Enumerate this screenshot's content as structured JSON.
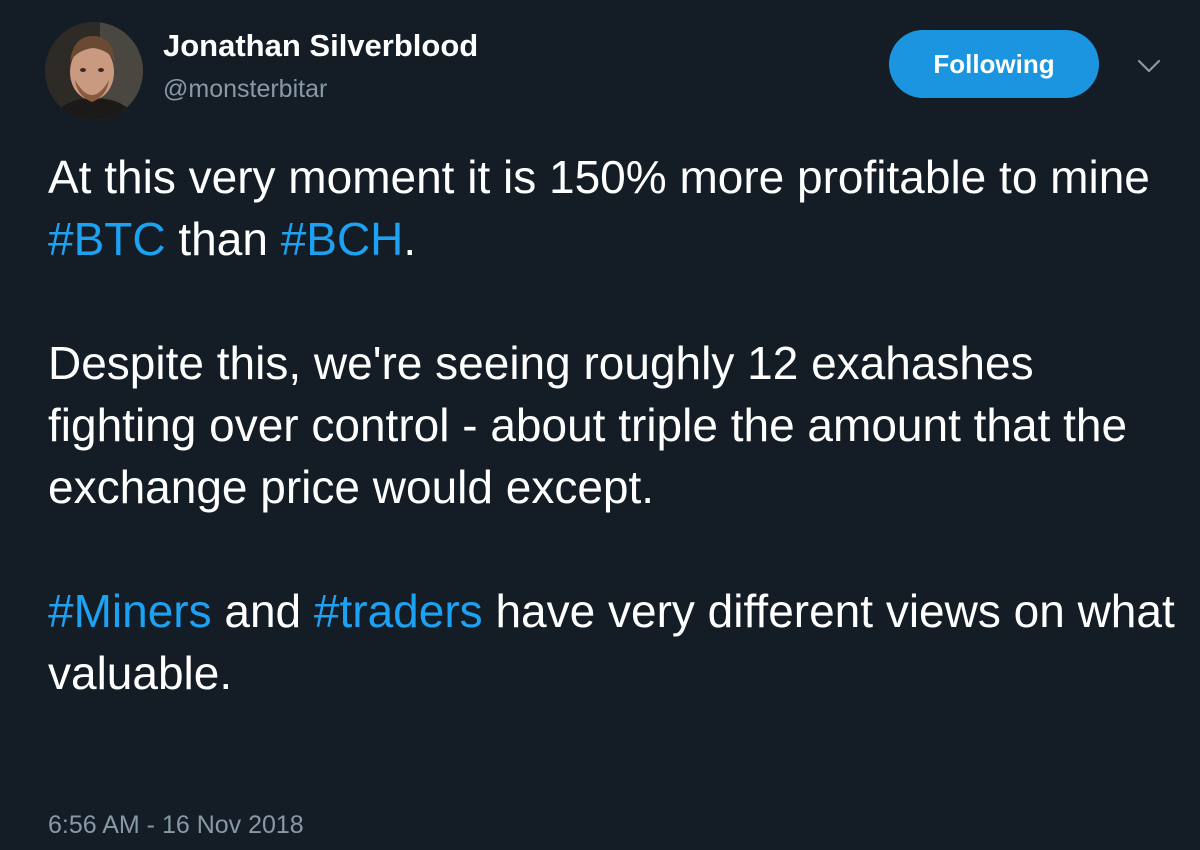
{
  "author": {
    "display_name": "Jonathan Silverblood",
    "handle": "@monsterbitar",
    "avatar": "avatar-photo"
  },
  "follow_button": {
    "label": "Following",
    "color": "#1b95e0"
  },
  "menu": {
    "icon": "chevron-down-icon"
  },
  "tweet": {
    "paragraph1": {
      "part1": "At this very moment it is 150% more profitable to mine ",
      "hashtag1": "#BTC",
      "part2": " than ",
      "hashtag2": "#BCH",
      "part3": "."
    },
    "paragraph2": {
      "text": "Despite this, we're seeing roughly 12 exahashes fighting over control - about triple the amount that the exchange price would except."
    },
    "paragraph3": {
      "hashtag1": "#Miners",
      "part1": " and ",
      "hashtag2": "#traders",
      "part2": " have very different views on what valuable."
    },
    "timestamp": "6:56 AM - 16 Nov 2018"
  },
  "colors": {
    "background": "#141d26",
    "text": "#ffffff",
    "secondary_text": "#8899a6",
    "hashtag": "#1da1f2"
  }
}
